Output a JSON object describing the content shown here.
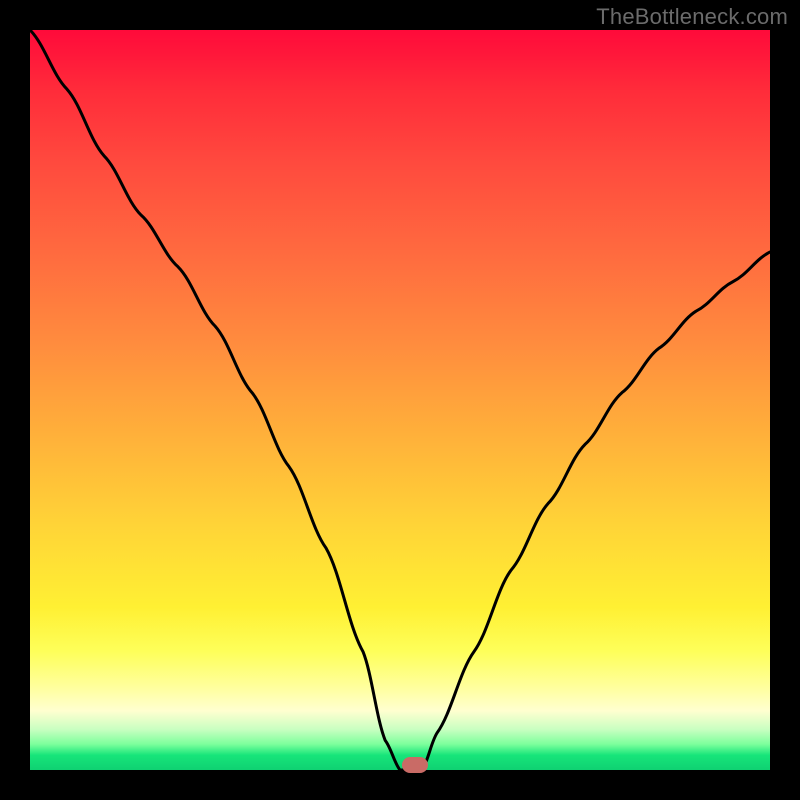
{
  "watermark": "TheBottleneck.com",
  "chart_data": {
    "type": "line",
    "title": "",
    "xlabel": "",
    "ylabel": "",
    "xlim": [
      0,
      100
    ],
    "ylim": [
      0,
      100
    ],
    "grid": false,
    "series": [
      {
        "name": "bottleneck-curve",
        "x": [
          0,
          5,
          10,
          15,
          20,
          25,
          30,
          35,
          40,
          45,
          48,
          50,
          52,
          53,
          55,
          60,
          65,
          70,
          75,
          80,
          85,
          90,
          95,
          100
        ],
        "y": [
          100,
          92,
          83,
          75,
          68,
          60,
          51,
          41,
          30,
          16,
          4,
          0,
          0,
          0,
          5,
          16,
          27,
          36,
          44,
          51,
          57,
          62,
          66,
          70
        ]
      }
    ],
    "marker": {
      "x": 52,
      "y": 0.7,
      "color": "#c96b66"
    },
    "background_gradient": {
      "orientation": "vertical",
      "stops": [
        {
          "pos": 0.0,
          "color": "#ff0a3a"
        },
        {
          "pos": 0.3,
          "color": "#ff6a3f"
        },
        {
          "pos": 0.67,
          "color": "#ffd437"
        },
        {
          "pos": 0.89,
          "color": "#ffffa0"
        },
        {
          "pos": 0.96,
          "color": "#7dff9c"
        },
        {
          "pos": 1.0,
          "color": "#0fd172"
        }
      ]
    }
  }
}
